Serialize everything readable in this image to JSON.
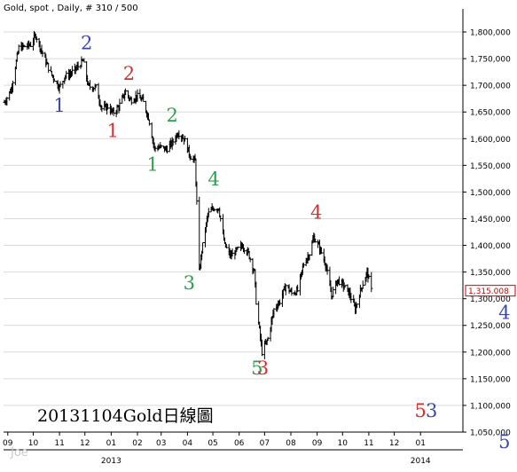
{
  "header": {
    "title": "Gold, spot , Daily, # 310 / 500"
  },
  "caption": "20131104Gold日線圖",
  "watermark": "Joe",
  "colors": {
    "bars": "#000000",
    "grid": "#d9d9d9",
    "wave_blue": "#3949ab",
    "wave_red": "#d32f2f",
    "wave_green": "#2e9e4e",
    "last_price_box": "#cc0000"
  },
  "chart_data": {
    "type": "line",
    "title": "Gold, spot , Daily, # 310 / 500",
    "x_type": "date",
    "x_range": [
      "2012-08-27",
      "2014-02-20"
    ],
    "ylim": [
      1050,
      1830
    ],
    "y_ticks": [
      1050,
      1100,
      1150,
      1200,
      1250,
      1300,
      1350,
      1400,
      1450,
      1500,
      1550,
      1600,
      1650,
      1700,
      1750,
      1800
    ],
    "y_tick_labels": [
      "1,050,000",
      "1,100,000",
      "1,150,000",
      "1,200,000",
      "1,250,000",
      "1,300,000",
      "1,350,000",
      "1,400,000",
      "1,450,000",
      "1,500,000",
      "1,550,000",
      "1,600,000",
      "1,650,000",
      "1,700,000",
      "1,750,000",
      "1,800,000"
    ],
    "x_ticks": [
      {
        "date": "2012-09-01",
        "label": "09"
      },
      {
        "date": "2012-10-01",
        "label": "10"
      },
      {
        "date": "2012-11-01",
        "label": "11"
      },
      {
        "date": "2012-12-01",
        "label": "12"
      },
      {
        "date": "2013-01-01",
        "label": "01"
      },
      {
        "date": "2013-02-01",
        "label": "02"
      },
      {
        "date": "2013-03-01",
        "label": "03"
      },
      {
        "date": "2013-04-01",
        "label": "04"
      },
      {
        "date": "2013-05-01",
        "label": "05"
      },
      {
        "date": "2013-06-01",
        "label": "06"
      },
      {
        "date": "2013-07-01",
        "label": "07"
      },
      {
        "date": "2013-08-01",
        "label": "08"
      },
      {
        "date": "2013-09-01",
        "label": "09"
      },
      {
        "date": "2013-10-01",
        "label": "10"
      },
      {
        "date": "2013-11-01",
        "label": "11"
      },
      {
        "date": "2013-12-01",
        "label": "12"
      },
      {
        "date": "2014-01-01",
        "label": "01"
      }
    ],
    "year_labels": [
      {
        "date": "2013-01-01",
        "label": "2013"
      },
      {
        "date": "2014-01-01",
        "label": "2014"
      }
    ],
    "last_price": "1,315.008",
    "last_price_value": 1315,
    "series": [
      {
        "points": [
          {
            "date": "2012-08-28",
            "value": 1668
          },
          {
            "date": "2012-09-05",
            "value": 1692
          },
          {
            "date": "2012-09-14",
            "value": 1770
          },
          {
            "date": "2012-09-28",
            "value": 1776
          },
          {
            "date": "2012-10-04",
            "value": 1794
          },
          {
            "date": "2012-10-15",
            "value": 1748
          },
          {
            "date": "2012-10-22",
            "value": 1722
          },
          {
            "date": "2012-10-26",
            "value": 1712
          },
          {
            "date": "2012-11-01",
            "value": 1696
          },
          {
            "date": "2012-11-07",
            "value": 1716
          },
          {
            "date": "2012-11-14",
            "value": 1722
          },
          {
            "date": "2012-11-21",
            "value": 1732
          },
          {
            "date": "2012-11-29",
            "value": 1746
          },
          {
            "date": "2012-12-05",
            "value": 1698
          },
          {
            "date": "2012-12-14",
            "value": 1696
          },
          {
            "date": "2012-12-21",
            "value": 1656
          },
          {
            "date": "2012-12-28",
            "value": 1660
          },
          {
            "date": "2013-01-03",
            "value": 1648
          },
          {
            "date": "2013-01-10",
            "value": 1660
          },
          {
            "date": "2013-01-18",
            "value": 1688
          },
          {
            "date": "2013-01-24",
            "value": 1672
          },
          {
            "date": "2013-01-31",
            "value": 1680
          },
          {
            "date": "2013-02-07",
            "value": 1672
          },
          {
            "date": "2013-02-14",
            "value": 1640
          },
          {
            "date": "2013-02-21",
            "value": 1582
          },
          {
            "date": "2013-02-28",
            "value": 1584
          },
          {
            "date": "2013-03-07",
            "value": 1580
          },
          {
            "date": "2013-03-14",
            "value": 1592
          },
          {
            "date": "2013-03-21",
            "value": 1612
          },
          {
            "date": "2013-03-28",
            "value": 1600
          },
          {
            "date": "2013-04-04",
            "value": 1568
          },
          {
            "date": "2013-04-10",
            "value": 1558
          },
          {
            "date": "2013-04-12",
            "value": 1480
          },
          {
            "date": "2013-04-15",
            "value": 1350
          },
          {
            "date": "2013-04-18",
            "value": 1390
          },
          {
            "date": "2013-04-25",
            "value": 1458
          },
          {
            "date": "2013-05-02",
            "value": 1470
          },
          {
            "date": "2013-05-08",
            "value": 1470
          },
          {
            "date": "2013-05-15",
            "value": 1400
          },
          {
            "date": "2013-05-22",
            "value": 1380
          },
          {
            "date": "2013-05-29",
            "value": 1390
          },
          {
            "date": "2013-06-05",
            "value": 1400
          },
          {
            "date": "2013-06-12",
            "value": 1385
          },
          {
            "date": "2013-06-19",
            "value": 1350
          },
          {
            "date": "2013-06-21",
            "value": 1295
          },
          {
            "date": "2013-06-28",
            "value": 1200
          },
          {
            "date": "2013-07-05",
            "value": 1225
          },
          {
            "date": "2013-07-12",
            "value": 1280
          },
          {
            "date": "2013-07-19",
            "value": 1295
          },
          {
            "date": "2013-07-26",
            "value": 1325
          },
          {
            "date": "2013-08-02",
            "value": 1310
          },
          {
            "date": "2013-08-09",
            "value": 1315
          },
          {
            "date": "2013-08-16",
            "value": 1365
          },
          {
            "date": "2013-08-23",
            "value": 1385
          },
          {
            "date": "2013-08-28",
            "value": 1415
          },
          {
            "date": "2013-09-04",
            "value": 1395
          },
          {
            "date": "2013-09-11",
            "value": 1365
          },
          {
            "date": "2013-09-18",
            "value": 1305
          },
          {
            "date": "2013-09-25",
            "value": 1335
          },
          {
            "date": "2013-10-02",
            "value": 1325
          },
          {
            "date": "2013-10-09",
            "value": 1310
          },
          {
            "date": "2013-10-16",
            "value": 1280
          },
          {
            "date": "2013-10-23",
            "value": 1320
          },
          {
            "date": "2013-10-30",
            "value": 1350
          },
          {
            "date": "2013-11-04",
            "value": 1315
          }
        ]
      }
    ],
    "annotations": [
      {
        "text": "1",
        "color": "#3949ab",
        "date": "2012-11-01",
        "value": 1650
      },
      {
        "text": "2",
        "color": "#3949ab",
        "date": "2012-12-03",
        "value": 1768
      },
      {
        "text": "2",
        "color": "#d32f2f",
        "date": "2013-01-22",
        "value": 1710
      },
      {
        "text": "1",
        "color": "#d32f2f",
        "date": "2013-01-03",
        "value": 1603
      },
      {
        "text": "2",
        "color": "#2e9e4e",
        "date": "2013-03-14",
        "value": 1632
      },
      {
        "text": "1",
        "color": "#2e9e4e",
        "date": "2013-02-19",
        "value": 1540
      },
      {
        "text": "4",
        "color": "#2e9e4e",
        "date": "2013-05-02",
        "value": 1512
      },
      {
        "text": "3",
        "color": "#2e9e4e",
        "date": "2013-04-03",
        "value": 1318
      },
      {
        "text": "5",
        "color": "#2e9e4e",
        "date": "2013-06-22",
        "value": 1158
      },
      {
        "text": "3",
        "color": "#d32f2f",
        "date": "2013-06-29",
        "value": 1158
      },
      {
        "text": "4",
        "color": "#d32f2f",
        "date": "2013-08-31",
        "value": 1450
      },
      {
        "text": "5",
        "color": "#d32f2f",
        "date": "2014-01-01",
        "value": 1078
      },
      {
        "text": "3",
        "color": "#3949ab",
        "date": "2014-01-14",
        "value": 1078
      },
      {
        "text": "4",
        "color": "#3949ab",
        "date": "2014-04-10",
        "value": 1262
      },
      {
        "text": "5",
        "color": "#3949ab",
        "date": "2014-04-10",
        "value": 1020
      }
    ]
  }
}
